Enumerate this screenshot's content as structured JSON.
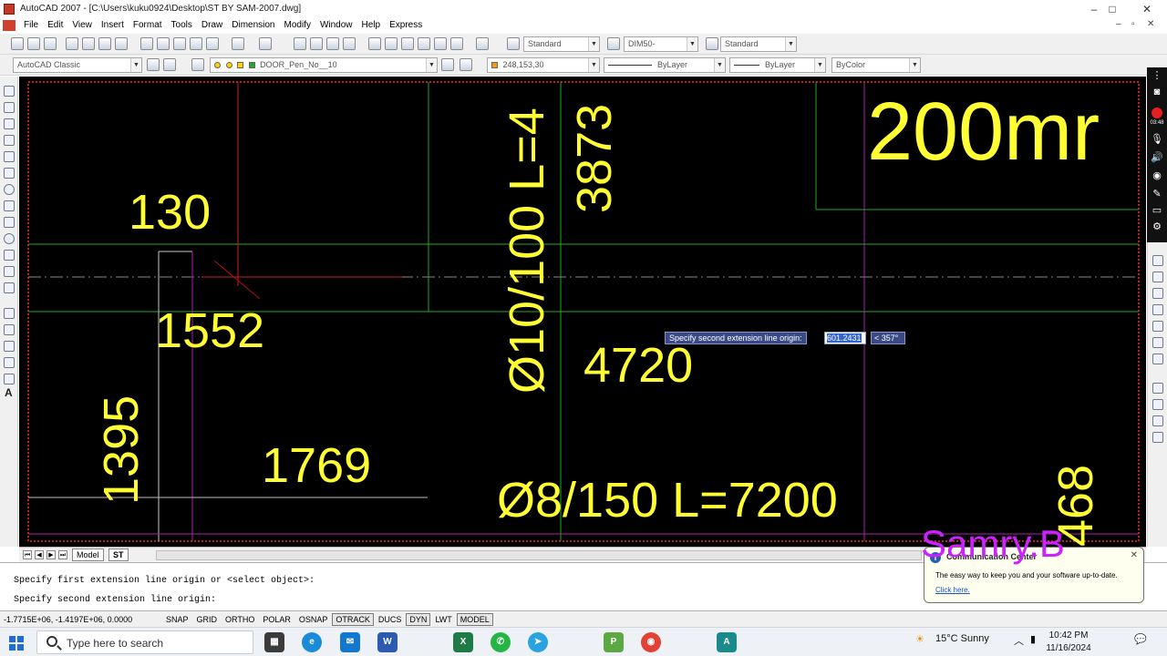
{
  "window": {
    "title": "AutoCAD 2007 - [C:\\Users\\kuku0924\\Desktop\\ST BY SAM-2007.dwg]",
    "controls": [
      "–",
      "□",
      "✕"
    ]
  },
  "menubar": {
    "items": [
      "File",
      "Edit",
      "View",
      "Insert",
      "Format",
      "Tools",
      "Draw",
      "Dimension",
      "Modify",
      "Window",
      "Help",
      "Express"
    ],
    "doc_controls": [
      "–",
      "▫",
      "✕"
    ]
  },
  "toolbar1": {
    "text_style": "Standard",
    "dim_style": "DIM50-",
    "table_style": "Standard"
  },
  "toolbar2": {
    "workspace": "AutoCAD Classic",
    "layer": "DOOR_Pen_No__10",
    "color": "248,153,30",
    "color_hex": "#f8991e",
    "linetype": "ByLayer",
    "lineweight": "ByLayer",
    "plotstyle": "ByColor"
  },
  "drawing": {
    "dims": {
      "d130": "130",
      "d1552": "1552",
      "d1395": "1395",
      "d1769": "1769",
      "bar1": "Ø10/100 L=4",
      "d3873": "3873",
      "d4720": "4720",
      "bar2": "Ø8/150 L=7200",
      "thickness": "200mr",
      "d468": "468"
    },
    "text_color": "#ffff33"
  },
  "dynamic_input": {
    "prompt": "Specify second extension line origin:",
    "distance": "601.2431",
    "angle": "< 357°"
  },
  "layout_tabs": {
    "nav": [
      "⏮",
      "◀",
      "▶",
      "⏭"
    ],
    "tabs": [
      "Model",
      "ST"
    ],
    "active": "ST"
  },
  "command": {
    "line1": "Specify first extension line origin or <select object>:",
    "line2": "Specify second extension line origin:"
  },
  "statusbar": {
    "coords": "-1.7715E+06, -1.4197E+06, 0.0000",
    "buttons": [
      "SNAP",
      "GRID",
      "ORTHO",
      "POLAR",
      "OSNAP",
      "OTRACK",
      "DUCS",
      "DYN",
      "LWT",
      "MODEL"
    ],
    "on_buttons": [
      "OTRACK",
      "DYN",
      "MODEL"
    ]
  },
  "notification": {
    "title": "Communication Center",
    "message": "The easy way to keep you and your software up-to-date.",
    "link": "Click here."
  },
  "watermark": "Samry.B",
  "recorder": {
    "time": "03:48"
  },
  "taskbar": {
    "search_placeholder": "Type here to search",
    "weather": "15°C  Sunny",
    "time": "10:42 PM",
    "date": "11/16/2024",
    "apps": [
      "task-view",
      "edge",
      "mail",
      "word",
      "excel",
      "whatsapp",
      "telegram",
      "paint",
      "chrome",
      "autocad"
    ]
  }
}
